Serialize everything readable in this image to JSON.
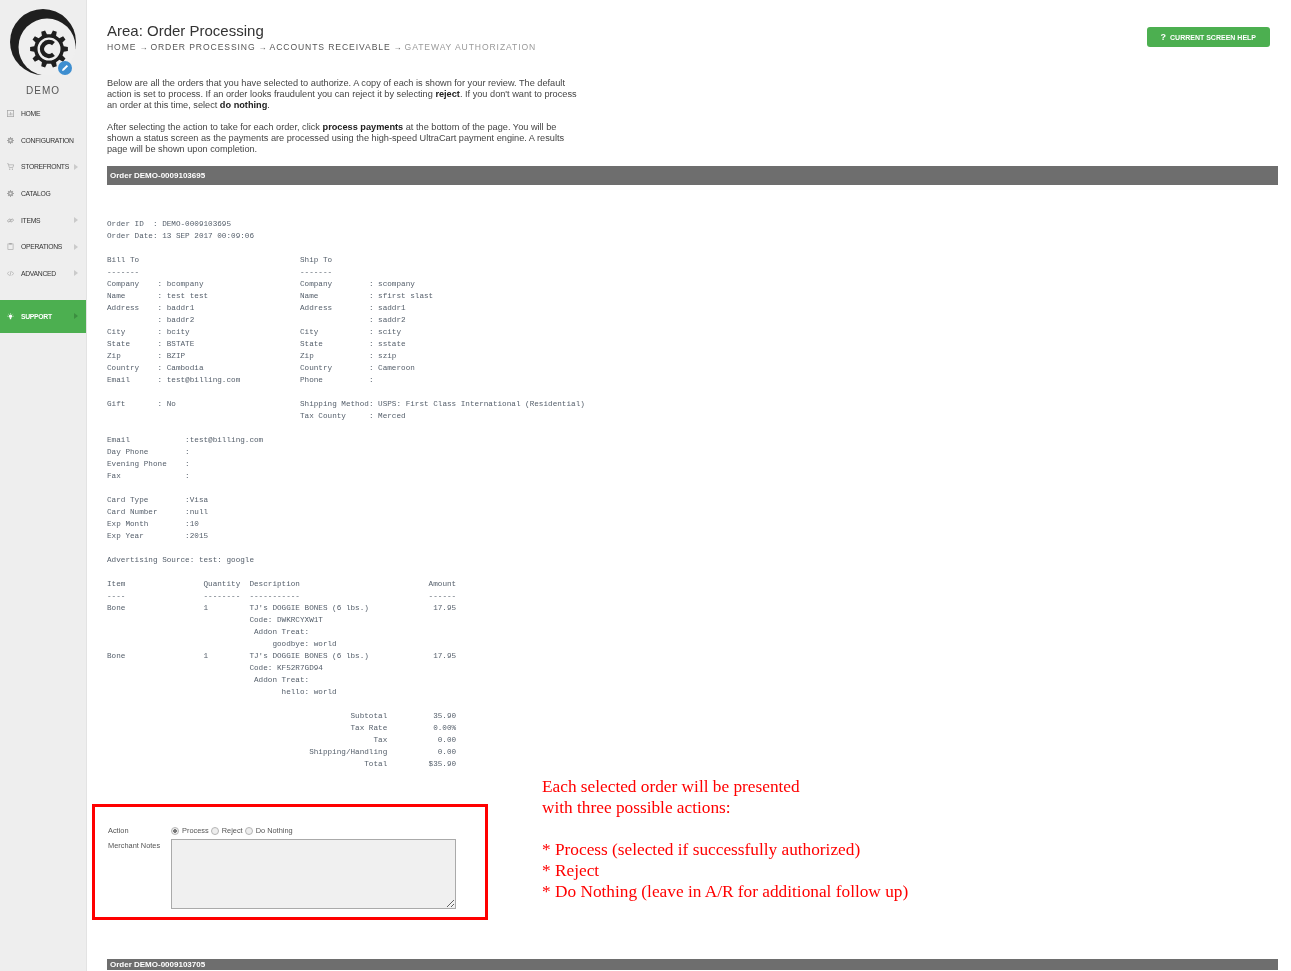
{
  "sidebar": {
    "account": "DEMO",
    "items": [
      {
        "label": "HOME",
        "has_submenu": false,
        "selected": false
      },
      {
        "label": "CONFIGURATION",
        "has_submenu": false,
        "selected": false
      },
      {
        "label": "STOREFRONTS",
        "has_submenu": true,
        "selected": false
      },
      {
        "label": "CATALOG",
        "has_submenu": false,
        "selected": false
      },
      {
        "label": "ITEMS",
        "has_submenu": true,
        "selected": false
      },
      {
        "label": "OPERATIONS",
        "has_submenu": true,
        "selected": false
      },
      {
        "label": "ADVANCED",
        "has_submenu": true,
        "selected": false
      }
    ],
    "bottom_items": [
      {
        "label": "SUPPORT",
        "has_submenu": true,
        "selected": true
      }
    ]
  },
  "header": {
    "title": "Area: Order Processing",
    "breadcrumb": [
      {
        "label": "HOME",
        "arrow": "→",
        "current": false
      },
      {
        "label": "ORDER PROCESSING",
        "arrow": "→",
        "current": false
      },
      {
        "label": "ACCOUNTS RECEIVABLE",
        "arrow": "→",
        "current": false
      },
      {
        "label": "GATEWAY AUTHORIZATION",
        "current": true
      }
    ],
    "help_button": {
      "glyph": "?",
      "label": "CURRENT SCREEN HELP"
    }
  },
  "intro": [
    "Below are all the orders that you have selected to authorize. A copy of each is shown for your review. The default action is set to process. If an order looks fraudulent you can reject it by selecting **reject**. If you don't want to process an order at this time, select **do nothing**.",
    "After selecting the action to take for each order, click **process payments** at the bottom of the page. You will be shown a status screen as the payments are processed using the high-speed UltraCart payment engine. A results page will be shown upon completion."
  ],
  "orders": [
    {
      "header": "Order DEMO-0009103695",
      "summary": [
        {
          "label": "Order ID",
          "value": ": DEMO-0009103695"
        },
        {
          "label": "Order Date",
          "value": ": 13 SEP 2017 00:09:06"
        }
      ],
      "bill_to": {
        "title": "Bill To",
        "rule": "-------",
        "fields": [
          {
            "label": "Company",
            "value": ": bcompany"
          },
          {
            "label": "Name",
            "value": ": test test"
          },
          {
            "label": "Address",
            "value": ": baddr1"
          },
          {
            "value": ": baddr2"
          },
          {
            "label": "City",
            "value": ": bcity"
          },
          {
            "label": "State",
            "value": ": BSTATE"
          },
          {
            "label": "Zip",
            "value": ": BZIP"
          },
          {
            "label": "Country",
            "value": ": Cambodia"
          },
          {
            "label": "Email",
            "value": ": test@billing.com"
          }
        ],
        "extra_fields": [
          {
            "label": "Gift",
            "value": ": No"
          }
        ]
      },
      "ship_to": {
        "title": "Ship To",
        "rule": "-------",
        "fields": [
          {
            "label": "Company",
            "value": ": scompany"
          },
          {
            "label": "Name",
            "value": ": sfirst slast"
          },
          {
            "label": "Address",
            "value": ": saddr1"
          },
          {
            "value": ": saddr2"
          },
          {
            "label": "City",
            "value": ": scity"
          },
          {
            "label": "State",
            "value": ": sstate"
          },
          {
            "label": "Zip",
            "value": ": szip"
          },
          {
            "label": "Country",
            "value": ": Cameroon"
          },
          {
            "label": "Phone",
            "value": ":"
          }
        ],
        "extra_fields": [
          {
            "label": "Shipping Method",
            "value": ": USPS: First Class International (Residential)"
          },
          {
            "label": "Tax County",
            "value": ": Merced"
          }
        ]
      },
      "contact": [
        {
          "label": "Email",
          "value": ":test@billing.com"
        },
        {
          "label": "Day Phone",
          "value": ":"
        },
        {
          "label": "Evening Phone",
          "value": ":"
        },
        {
          "label": "Fax",
          "value": ":"
        }
      ],
      "payment": [
        {
          "label": "Card Type",
          "value": ":Visa"
        },
        {
          "label": "Card Number",
          "value": ":null"
        },
        {
          "label": "Exp Month",
          "value": ":10"
        },
        {
          "label": "Exp Year",
          "value": ":2015"
        }
      ],
      "advertising": {
        "label": "Advertising Source",
        "value": ": test: google"
      },
      "items": {
        "columns": [
          {
            "label": "Item",
            "rule": "----"
          },
          {
            "label": "Quantity",
            "rule": "--------"
          },
          {
            "label": "Description",
            "rule": "-----------"
          },
          {
            "label": "Amount",
            "rule": "------"
          }
        ],
        "rows": [
          {
            "item": "Bone",
            "quantity": "1",
            "description": "TJ's DOGGIE BONES (6 lbs.)",
            "code": "Code: DWKRCYXW1T",
            "options": [
              {
                "name": "Addon Treat:",
                "value": "goodbye: world"
              }
            ],
            "amount": "17.95"
          },
          {
            "item": "Bone",
            "quantity": "1",
            "description": "TJ's DOGGIE BONES (6 lbs.)",
            "code": "Code: KF52R7GD94",
            "options": [
              {
                "name": "Addon Treat:",
                "value": "hello: world"
              }
            ],
            "amount": "17.95"
          }
        ]
      },
      "totals": [
        {
          "label": "Subtotal",
          "value": "35.90"
        },
        {
          "label": "Tax Rate",
          "value": "0.00%"
        },
        {
          "label": "Tax",
          "value": "0.00"
        },
        {
          "label": "Shipping/Handling",
          "value": "0.00"
        },
        {
          "label": "Total",
          "value": "$35.90"
        }
      ],
      "action": {
        "label": "Action",
        "options": [
          {
            "label": "Process",
            "selected": true
          },
          {
            "label": "Reject",
            "selected": false
          },
          {
            "label": "Do Nothing",
            "selected": false
          }
        ]
      },
      "notes": {
        "label": "Merchant Notes"
      },
      "annotation": {
        "intro": "Each selected order will be presented with three possible actions:",
        "bullets": [
          "* Process (selected if successfully authorized)",
          "* Reject",
          "* Do Nothing (leave in A/R for additional follow up)"
        ]
      }
    },
    {
      "header": "Order DEMO-0009103705"
    }
  ]
}
